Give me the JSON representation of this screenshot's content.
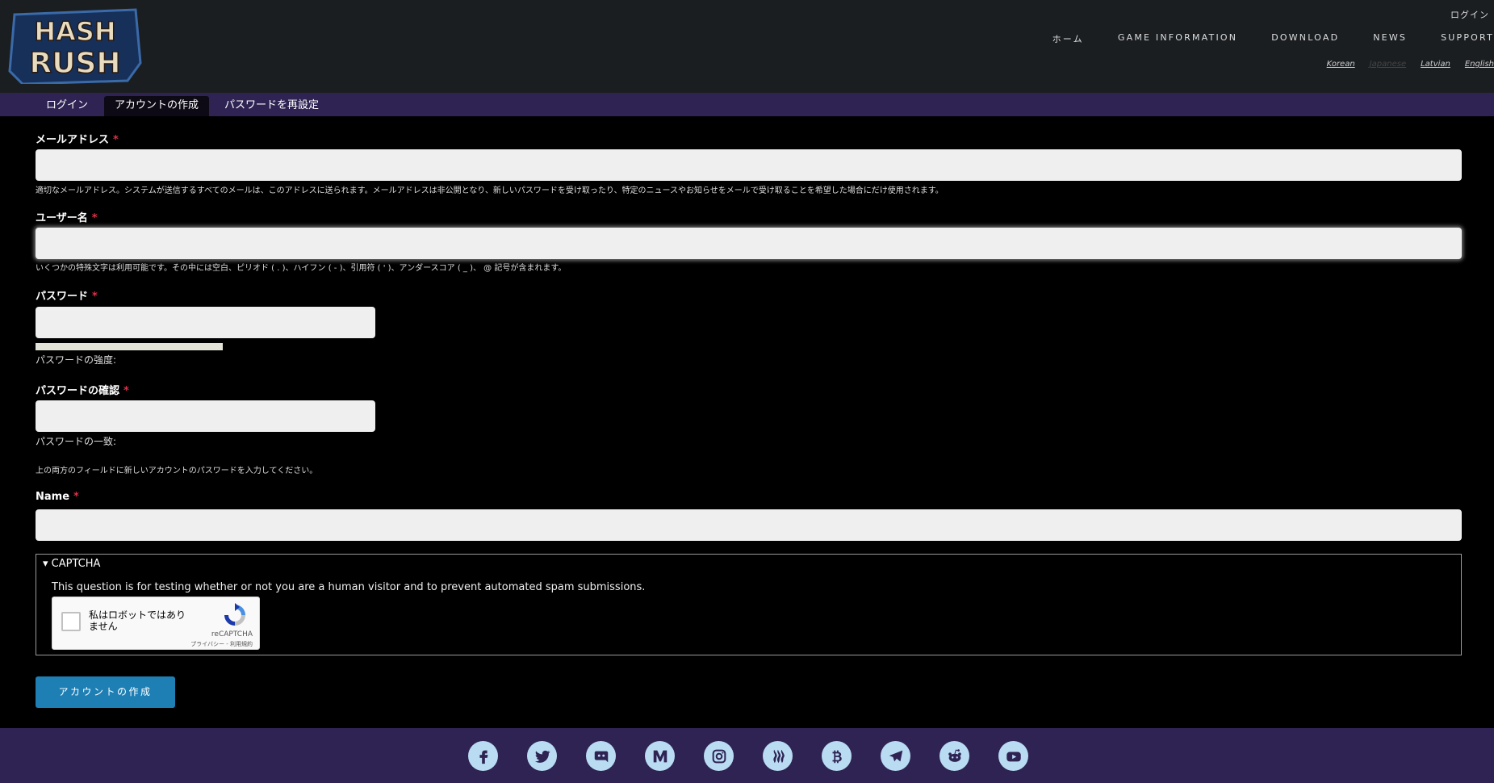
{
  "header": {
    "logo_text_1": "HASH",
    "logo_text_2": "RUSH",
    "top_login": "ログイン",
    "nav": [
      "ホーム",
      "GAME INFORMATION",
      "DOWNLOAD",
      "NEWS",
      "SUPPORT"
    ],
    "languages": [
      {
        "label": "Korean",
        "active": true
      },
      {
        "label": "Japanese",
        "active": false
      },
      {
        "label": "Latvian",
        "active": true
      },
      {
        "label": "English",
        "active": true
      }
    ]
  },
  "tabs": [
    {
      "label": "ログイン",
      "active": false
    },
    {
      "label": "アカウントの作成",
      "active": true
    },
    {
      "label": "パスワードを再設定",
      "active": false
    }
  ],
  "form": {
    "email": {
      "label": "メールアドレス",
      "required": "*",
      "value": "",
      "description": "適切なメールアドレス。システムが送信するすべてのメールは、このアドレスに送られます。メールアドレスは非公開となり、新しいパスワードを受け取ったり、特定のニュースやお知らせをメールで受け取ることを希望した場合にだけ使用されます。"
    },
    "username": {
      "label": "ユーザー名",
      "required": "*",
      "value": "",
      "description": "いくつかの特殊文字は利用可能です。その中には空白、ピリオド ( . )、ハイフン ( - )、引用符 ( ' )、アンダースコア ( _ )、 @ 記号が含まれます。"
    },
    "password": {
      "label": "パスワード",
      "required": "*",
      "value": "",
      "strength_label": "パスワードの強度:"
    },
    "password_confirm": {
      "label": "パスワードの確認",
      "required": "*",
      "value": "",
      "match_label": "パスワードの一致:"
    },
    "password_help": "上の両方のフィールドに新しいアカウントのパスワードを入力してください。",
    "name": {
      "label": "Name",
      "required": "*",
      "value": ""
    },
    "captcha": {
      "summary": "▾ CAPTCHA",
      "text": "This question is for testing whether or not you are a human visitor and to prevent automated spam submissions.",
      "checkbox_label": "私はロボットではありません",
      "brand": "reCAPTCHA",
      "terms": "プライバシー - 利用規約"
    },
    "submit_label": "アカウントの作成"
  },
  "footer": {
    "social_icons": [
      "facebook-icon",
      "twitter-icon",
      "discord-icon",
      "medium-icon",
      "instagram-icon",
      "steemit-icon",
      "bitcoin-icon",
      "telegram-icon",
      "reddit-icon",
      "youtube-icon"
    ]
  },
  "colors": {
    "header_bg": "#1b1e21",
    "tab_bar_bg": "#2e2353",
    "page_bg": "#000000",
    "accent_button": "#1e7fb5",
    "required_mark": "#e0304a",
    "social_icon_bg": "#b9dcf2"
  }
}
